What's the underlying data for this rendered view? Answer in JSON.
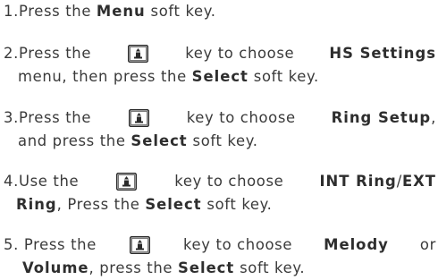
{
  "icons": {
    "nav_key": "up-down-navigation-key-icon"
  },
  "steps": [
    {
      "n": "1.",
      "t1": "Press the ",
      "b1": "Menu",
      "t2": " soft key."
    },
    {
      "n": "2.",
      "t1": "Press the",
      "t2": "key to choose",
      "b1": "HS Settings",
      "t3": "menu, then press the ",
      "b2": "Select",
      "t4": " soft key."
    },
    {
      "n": "3.",
      "t1": "Press the",
      "t2": "key to choose",
      "b1": "Ring Setup",
      "t3": ",",
      "t4": "and press the ",
      "b2": "Select",
      "t5": " soft key."
    },
    {
      "n": "4.",
      "t1": "Use the",
      "t2": "key to choose",
      "b1": "INT Ring",
      "t3": "/",
      "b2": "EXT",
      "b3": "Ring",
      "t4": ", Press the ",
      "b4": "Select",
      "t5": " soft key."
    },
    {
      "n": "5.",
      "t1": "Press the",
      "t2": "key to choose",
      "b1": "Melody",
      "t3": "or",
      "b2": "Volume",
      "t4": ", press the ",
      "b3": "Select",
      "t5": " soft key."
    }
  ]
}
